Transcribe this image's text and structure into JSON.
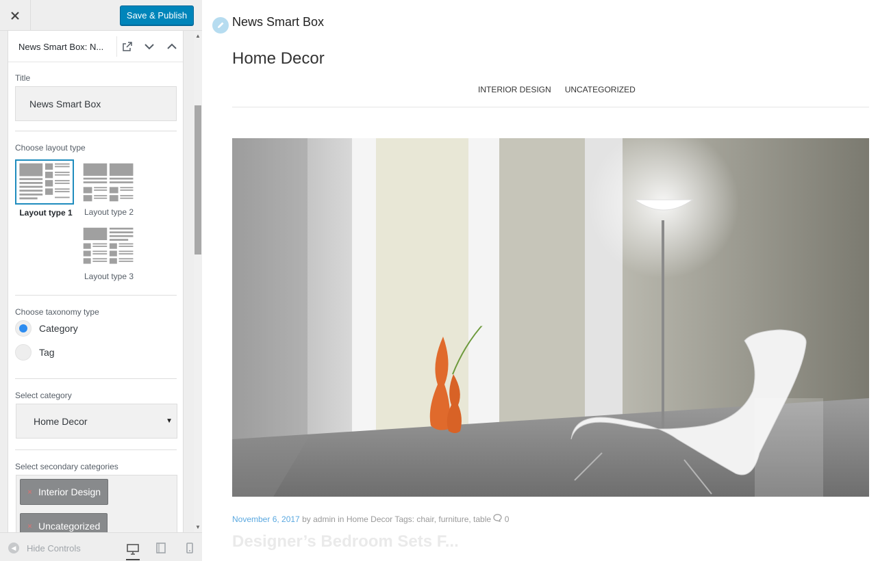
{
  "topbar": {
    "close_icon": "close-icon",
    "save_label": "Save & Publish",
    "save_color": "#0085ba"
  },
  "widget": {
    "title": "News Smart Box: N...",
    "icons": [
      "popout-icon",
      "chevron-down-icon",
      "chevron-up-icon"
    ]
  },
  "fields": {
    "title_label": "Title",
    "title_value": "News Smart Box",
    "layout_label": "Choose layout type",
    "layouts": [
      "Layout type 1",
      "Layout type 2",
      "Layout type 3"
    ],
    "layout_selected": "Layout type 1",
    "taxonomy_label": "Choose taxonomy type",
    "taxonomy_options": [
      "Category",
      "Tag"
    ],
    "taxonomy_selected": "Category",
    "category_label": "Select category",
    "category_value": "Home Decor",
    "secondary_label": "Select secondary categories",
    "secondary_values": [
      "Interior Design",
      "Uncategorized"
    ]
  },
  "footer": {
    "hide_controls": "Hide Controls",
    "device_icons": [
      "desktop-icon",
      "tablet-icon",
      "mobile-icon"
    ]
  },
  "preview": {
    "widget_heading": "News Smart Box",
    "section_title": "Home Decor",
    "tabs": [
      "INTERIOR DESIGN",
      "UNCATEGORIZED"
    ],
    "post": {
      "date": "November 6, 2017",
      "by": "by",
      "author": "admin",
      "in": "in",
      "category": "Home Decor",
      "tags_label": "Tags:",
      "tags": "chair, furniture, table",
      "comments": "0",
      "title": "Designer’s Bedroom Sets F..."
    },
    "accent_color": "#5aa8e0"
  }
}
